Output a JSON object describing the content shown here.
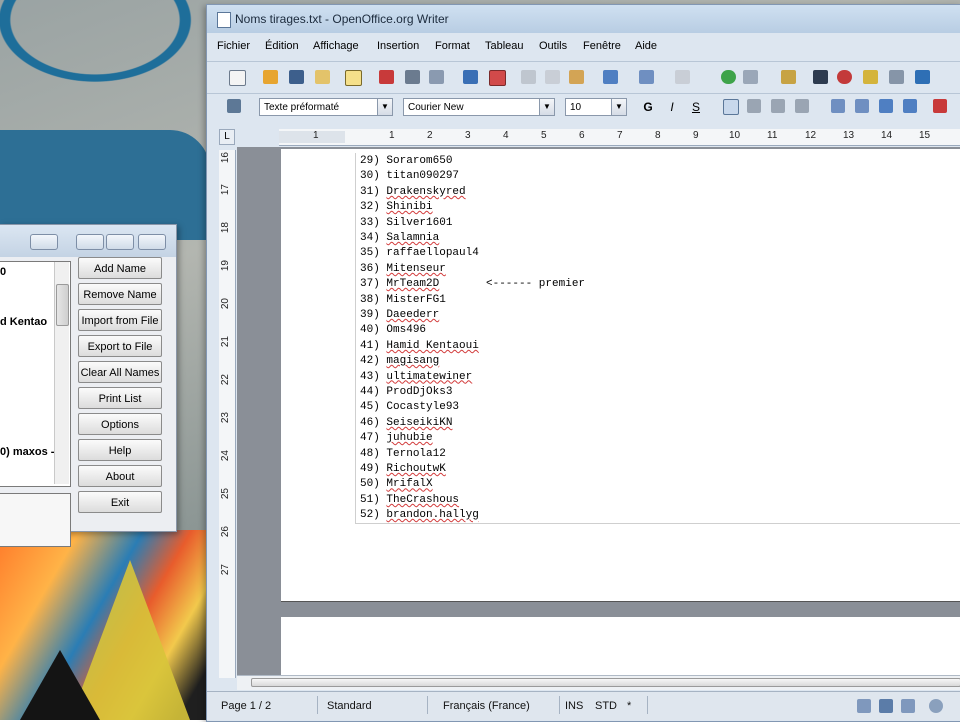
{
  "writer": {
    "title": "Noms tirages.txt - OpenOffice.org Writer",
    "menu": [
      "Fichier",
      "Édition",
      "Affichage",
      "Insertion",
      "Format",
      "Tableau",
      "Outils",
      "Fenêtre",
      "Aide"
    ],
    "style_value": "Texte préformaté",
    "font_value": "Courier New",
    "size_value": "10",
    "format_labels": {
      "bold": "G",
      "italic": "I",
      "underline": "S"
    },
    "ruler_h": [
      "1",
      "1",
      "2",
      "3",
      "4",
      "5",
      "6",
      "7",
      "8",
      "9",
      "10",
      "11",
      "12",
      "13",
      "14",
      "15"
    ],
    "ruler_v": [
      "16",
      "17",
      "18",
      "19",
      "20",
      "21",
      "22",
      "23",
      "24",
      "25",
      "26",
      "27"
    ],
    "lines": [
      {
        "num": "29)",
        "name": "Sorarom650"
      },
      {
        "num": "30)",
        "name": "titan090297"
      },
      {
        "num": "31)",
        "name": "Drakenskyred"
      },
      {
        "num": "32)",
        "name": "Shinibi"
      },
      {
        "num": "33)",
        "name": "Silver1601"
      },
      {
        "num": "34)",
        "name": "Salamnia"
      },
      {
        "num": "35)",
        "name": "raffaellopaul4"
      },
      {
        "num": "36)",
        "name": "Mitenseur"
      },
      {
        "num": "37)",
        "name": "MrTeam2D"
      },
      {
        "num": "38)",
        "name": "MisterFG1"
      },
      {
        "num": "39)",
        "name": "Daeederr"
      },
      {
        "num": "40)",
        "name": "Oms496"
      },
      {
        "num": "41)",
        "name": "Hamid Kentaoui"
      },
      {
        "num": "42)",
        "name": "magisang"
      },
      {
        "num": "43)",
        "name": "ultimatewiner"
      },
      {
        "num": "44)",
        "name": "ProdDjOks3"
      },
      {
        "num": "45)",
        "name": "Cocastyle93"
      },
      {
        "num": "46)",
        "name": "SeiseikiKN"
      },
      {
        "num": "47)",
        "name": "juhubie"
      },
      {
        "num": "48)",
        "name": "Ternola12"
      },
      {
        "num": "49)",
        "name": "RichoutwK"
      },
      {
        "num": "50)",
        "name": "MrifalX"
      },
      {
        "num": "51)",
        "name": "TheCrashous"
      },
      {
        "num": "52)",
        "name": "brandon.hallyg"
      }
    ],
    "winner_note": "<------ premier",
    "status": {
      "page": "Page 1 / 2",
      "style": "Standard",
      "lang": "Français (France)",
      "ins": "INS",
      "std": "STD",
      "mod": "*"
    }
  },
  "picker": {
    "list_items": [
      "0",
      "d Kentao",
      "0) maxos -"
    ],
    "buttons": [
      "Add Name",
      "Remove Name",
      "Import from File",
      "Export to File",
      "Clear All Names",
      "Print List",
      "Options",
      "Help",
      "About",
      "Exit"
    ]
  },
  "colors": {
    "spell_underline": "#d23b3b",
    "title_bar": "#c2d5e9"
  }
}
